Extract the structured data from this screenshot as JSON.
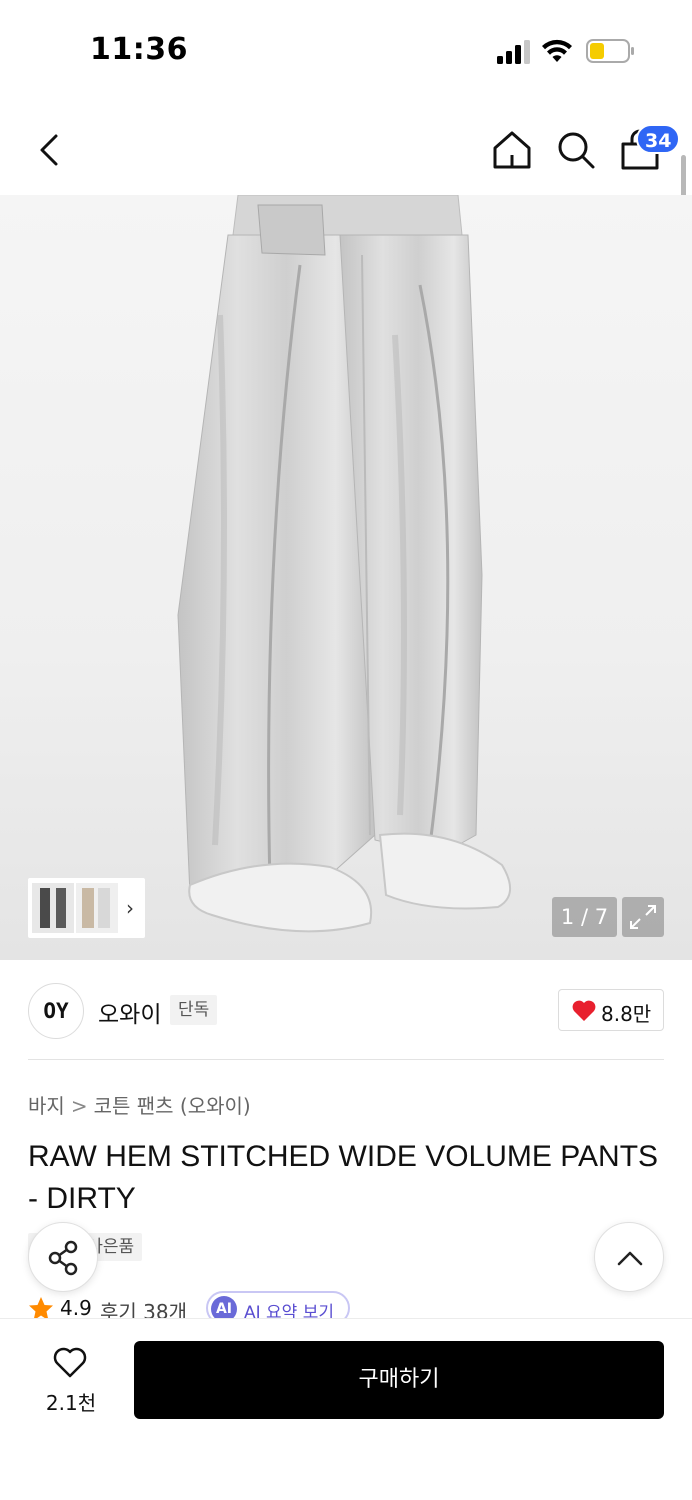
{
  "status_bar": {
    "time": "11:36"
  },
  "nav": {
    "cart_count": "34"
  },
  "gallery": {
    "counter": "1 / 7",
    "thumb_arrow": "›"
  },
  "brand": {
    "logo_text": "OY",
    "name": "오와이",
    "tag": "단독",
    "likes": "8.8만"
  },
  "breadcrumb": {
    "category": "바지",
    "separator": ">",
    "subcategory": "코튼 팬츠 (오와이)"
  },
  "product": {
    "title": "RAW HEM STITCHED WIDE VOLUME PANTS - DIRTY",
    "tags": [
      "단독",
      "사은품"
    ]
  },
  "rating": {
    "value": "4.9",
    "reviews": "후기 38개",
    "ai_badge": "AI",
    "ai_label": "AI 요약 보기"
  },
  "bottom_bar": {
    "wishlist_count": "2.1천",
    "buy_label": "구매하기"
  },
  "colors": {
    "accent_blue": "#2f66f5",
    "heart_red": "#e8202e",
    "star_orange": "#ff8a00",
    "ai_purple": "#5a4ed1"
  },
  "icons": [
    "back-icon",
    "home-icon",
    "search-icon",
    "cart-icon",
    "expand-icon",
    "heart-icon",
    "star-icon",
    "share-icon",
    "chevron-up-icon"
  ]
}
